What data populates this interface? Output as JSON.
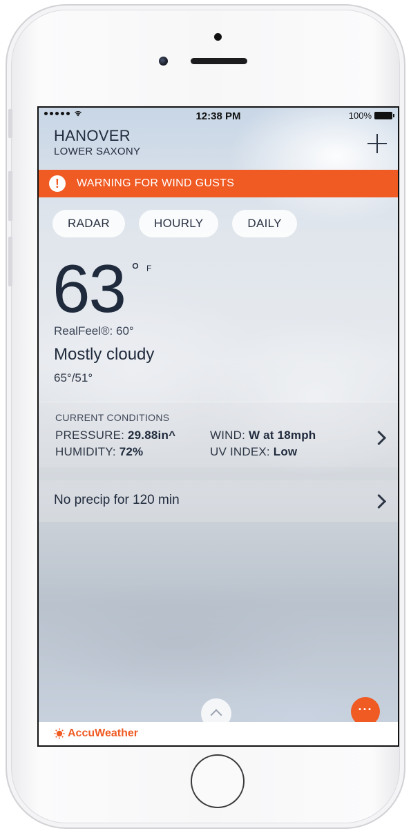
{
  "status_bar": {
    "time": "12:38 PM",
    "battery": "100%"
  },
  "location": {
    "city": "HANOVER",
    "region": "LOWER SAXONY"
  },
  "alert": {
    "text": "WARNING FOR WIND GUSTS",
    "color": "#f05a23"
  },
  "nav": {
    "radar": "RADAR",
    "hourly": "HOURLY",
    "daily": "DAILY"
  },
  "current": {
    "temperature": "63",
    "degree_symbol": "°",
    "unit": "F",
    "realfeel": "RealFeel®: 60°",
    "condition": "Mostly cloudy",
    "hi_lo": "65°/51°"
  },
  "conditions": {
    "header": "CURRENT CONDITIONS",
    "pressure_label": "PRESSURE:",
    "pressure_value": "29.88in",
    "pressure_trend": "^",
    "humidity_label": "HUMIDITY:",
    "humidity_value": "72%",
    "wind_label": "WIND:",
    "wind_value": "W at 18mph",
    "uv_label": "UV INDEX:",
    "uv_value": "Low"
  },
  "precip": {
    "text": "No precip for 120 min"
  },
  "footer": {
    "logo_text": "AccuWeather",
    "more_label": "···"
  },
  "icons": {
    "wifi": "wifi-icon",
    "battery": "battery-icon",
    "add": "plus-icon",
    "warning": "exclamation-icon",
    "chevron": "chevron-right-icon",
    "pull_up": "chevron-up-icon",
    "more": "ellipsis-icon",
    "logo": "sun-icon"
  }
}
